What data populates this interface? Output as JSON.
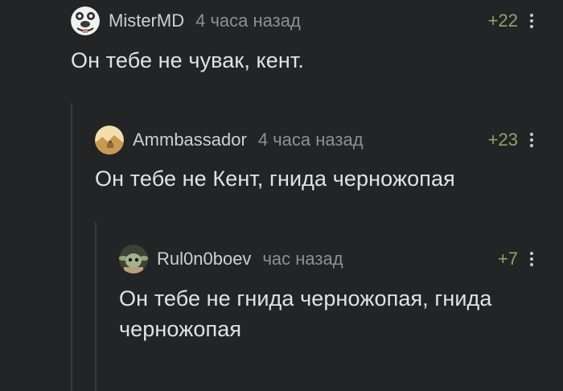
{
  "comments": [
    {
      "username": "MisterMD",
      "time": "4 часа назад",
      "rating": "+22",
      "avatar_icon": "cartoon-face-avatar-icon",
      "text": "Он тебе не чувак, кент."
    },
    {
      "username": "Ammbassador",
      "time": "4 часа назад",
      "rating": "+23",
      "avatar_icon": "landscape-avatar-icon",
      "text": "Он тебе не Кент, гнида черножопая"
    },
    {
      "username": "Rul0n0boev",
      "time": "час назад",
      "rating": "+7",
      "avatar_icon": "alien-avatar-icon",
      "text": "Он тебе не гнида черножопая, гнида черножопая"
    }
  ],
  "colors": {
    "background": "#232425",
    "rating_positive": "#8ea56a",
    "thread_line": "#3a3b3c"
  }
}
